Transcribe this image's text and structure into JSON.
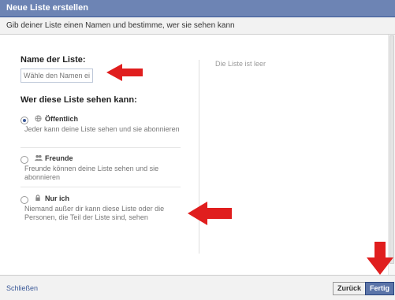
{
  "dialog": {
    "title": "Neue Liste erstellen",
    "subtitle": "Gib deiner Liste einen Namen und bestimme, wer sie sehen kann"
  },
  "form": {
    "name_label": "Name der Liste:",
    "name_placeholder": "Wähle den Namen eine",
    "visibility_label": "Wer diese Liste sehen kann:",
    "options": [
      {
        "icon": "globe-icon",
        "title": "Öffentlich",
        "desc": "Jeder kann deine Liste sehen und sie abonnieren",
        "selected": true
      },
      {
        "icon": "friends-icon",
        "title": "Freunde",
        "desc": "Freunde können deine Liste sehen und sie abonnieren",
        "selected": false
      },
      {
        "icon": "lock-icon",
        "title": "Nur ich",
        "desc": "Niemand außer dir kann diese Liste oder die Personen, die Teil der Liste sind, sehen",
        "selected": false
      }
    ]
  },
  "preview": {
    "empty_text": "Die Liste ist leer"
  },
  "footer": {
    "close_label": "Schließen",
    "back_label": "Zurück",
    "done_label": "Fertig"
  },
  "colors": {
    "titlebar": "#6d84b4",
    "primary_button": "#5b74a8",
    "annotation_arrow": "#e01e1e"
  }
}
